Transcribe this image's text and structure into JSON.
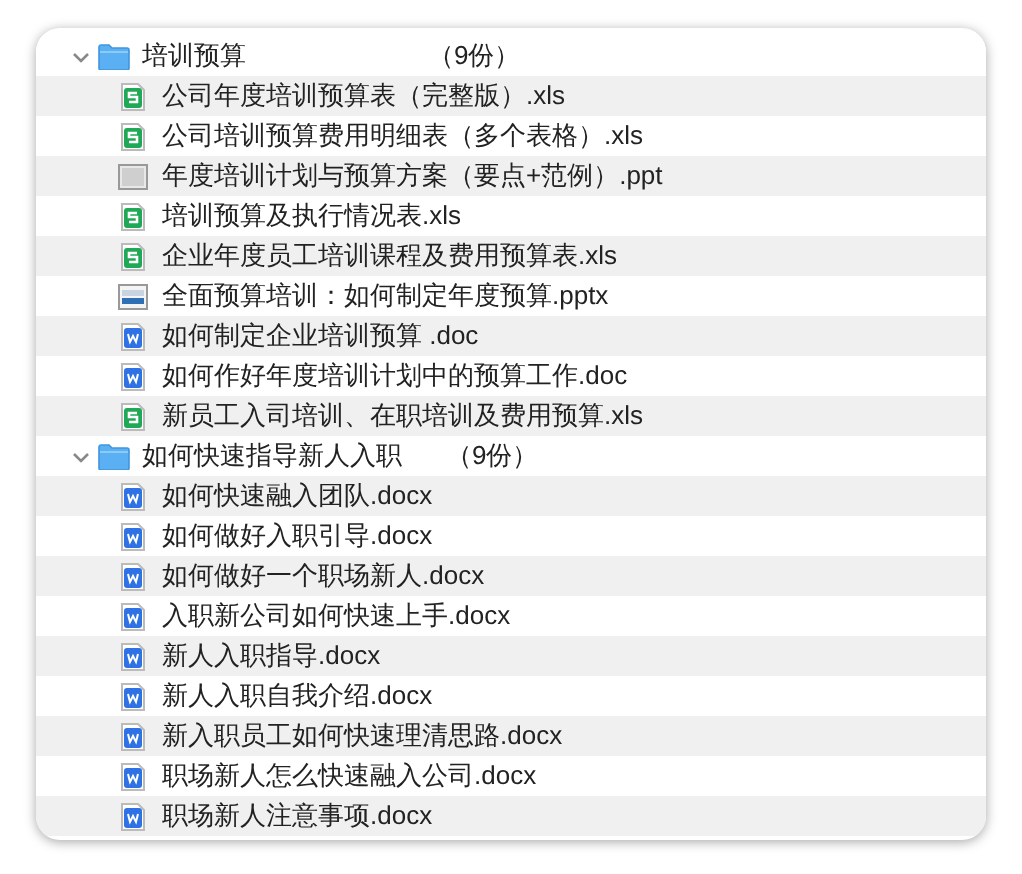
{
  "folders": [
    {
      "name": "培训预算",
      "count": "（9份）",
      "expanded": true,
      "files": [
        {
          "name": "公司年度培训预算表（完整版）.xls",
          "kind": "sheet"
        },
        {
          "name": "公司培训预算费用明细表（多个表格）.xls",
          "kind": "sheet"
        },
        {
          "name": "年度培训计划与预算方案（要点+范例）.ppt",
          "kind": "slide"
        },
        {
          "name": "培训预算及执行情况表.xls",
          "kind": "sheet"
        },
        {
          "name": "企业年度员工培训课程及费用预算表.xls",
          "kind": "sheet"
        },
        {
          "name": "全面预算培训：如何制定年度预算.pptx",
          "kind": "slideshow"
        },
        {
          "name": "如何制定企业培训预算 .doc",
          "kind": "doc"
        },
        {
          "name": "如何作好年度培训计划中的预算工作.doc",
          "kind": "doc"
        },
        {
          "name": "新员工入司培训、在职培训及费用预算.xls",
          "kind": "sheet"
        }
      ]
    },
    {
      "name": "如何快速指导新人入职",
      "count": "（9份）",
      "expanded": true,
      "files": [
        {
          "name": "如何快速融入团队.docx",
          "kind": "doc"
        },
        {
          "name": "如何做好入职引导.docx",
          "kind": "doc"
        },
        {
          "name": "如何做好一个职场新人.docx",
          "kind": "doc"
        },
        {
          "name": "入职新公司如何快速上手.docx",
          "kind": "doc"
        },
        {
          "name": "新人入职指导.docx",
          "kind": "doc"
        },
        {
          "name": "新人入职自我介绍.docx",
          "kind": "doc"
        },
        {
          "name": "新入职员工如何快速理清思路.docx",
          "kind": "doc"
        },
        {
          "name": "职场新人怎么快速融入公司.docx",
          "kind": "doc"
        },
        {
          "name": "职场新人注意事项.docx",
          "kind": "doc"
        }
      ]
    }
  ]
}
